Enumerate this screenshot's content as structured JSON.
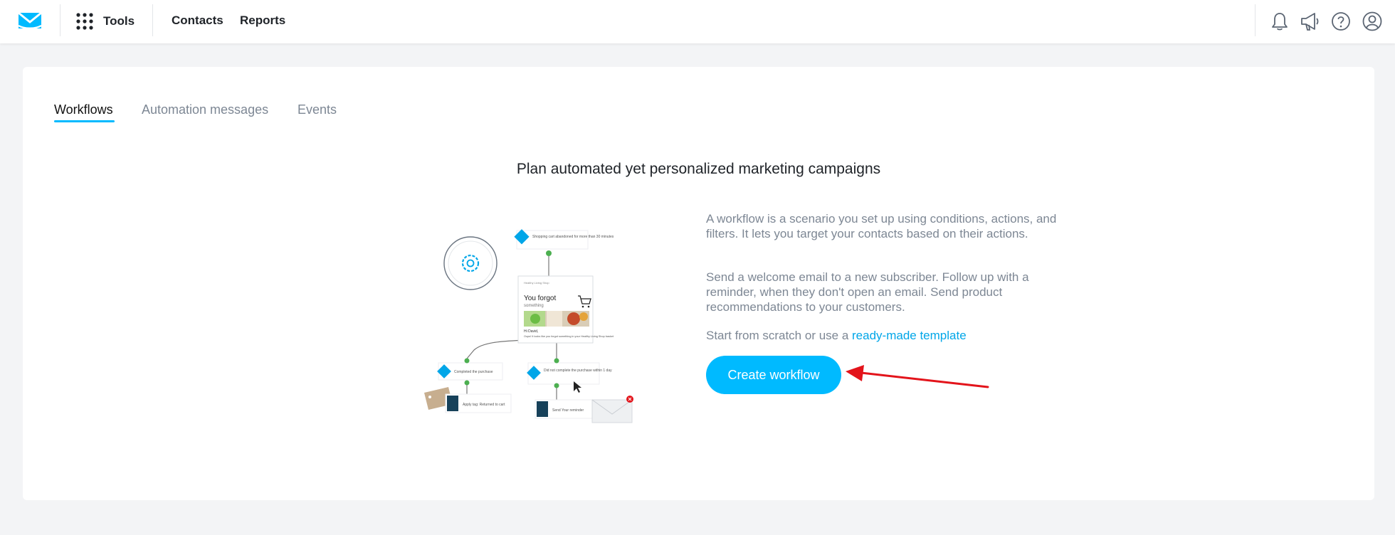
{
  "header": {
    "tools_label": "Tools",
    "nav": [
      {
        "label": "Contacts"
      },
      {
        "label": "Reports"
      }
    ],
    "icons": [
      "bell-icon",
      "megaphone-icon",
      "help-icon",
      "user-icon"
    ]
  },
  "tabs": [
    {
      "label": "Workflows",
      "active": true
    },
    {
      "label": "Automation messages",
      "active": false
    },
    {
      "label": "Events",
      "active": false
    }
  ],
  "main": {
    "headline": "Plan automated yet personalized marketing campaigns",
    "paragraph1": "A workflow is a scenario you set up using conditions, actions, and filters. It lets you target your contacts based on their actions.",
    "paragraph2": "Send a welcome email to a new subscriber. Follow up with a reminder, when they don't open an email. Send product recommendations to your customers.",
    "paragraph3_prefix": "Start from scratch or use a ",
    "template_link": "ready-made template",
    "cta_label": "Create workflow"
  },
  "illustration": {
    "node_abandoned": "Shopping cart abandoned for more than 30 minutes",
    "email_title": "You forgot",
    "email_subtitle": "something",
    "email_greeting": "Hi David,",
    "email_body": "Oops! It looks like you forgot something in your Healthy Living Shop basket",
    "node_completed": "Completed the purchase",
    "node_not_completed": "Did not complete the purchase within 1 day",
    "node_tag": "Apply tag: Returned to cart",
    "node_reminder": "Send Your reminder"
  },
  "colors": {
    "accent": "#00baff",
    "link": "#00a6e8",
    "annotation_arrow": "#e3141b",
    "background": "#f3f4f6"
  }
}
